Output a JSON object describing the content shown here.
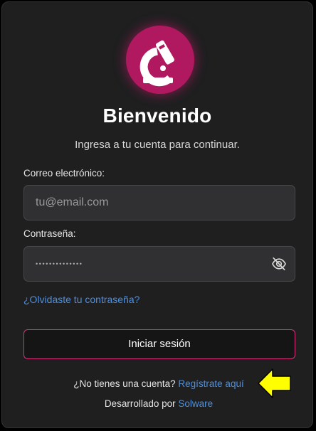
{
  "brand": {
    "logo_icon": "microscope-c-icon",
    "accent_color": "#b0195f",
    "button_border_color": "#d6337a",
    "link_color": "#4a90e2"
  },
  "header": {
    "title": "Bienvenido",
    "subtitle": "Ingresa a tu cuenta para continuar."
  },
  "form": {
    "email_label": "Correo electrónico:",
    "email_placeholder": "tu@email.com",
    "email_value": "",
    "password_label": "Contraseña:",
    "password_masked": "••••••••••••••",
    "password_toggle_icon": "eye-off-icon",
    "forgot_link": "¿Olvidaste tu contraseña?",
    "submit_label": "Iniciar sesión"
  },
  "footer": {
    "register_prompt": "¿No tienes una cuenta?",
    "register_link": "Regístrate aquí",
    "credit_prefix": "Desarrollado por",
    "credit_link": "Solware"
  },
  "annotation": {
    "icon": "arrow-left-icon",
    "color": "#ffff00"
  }
}
